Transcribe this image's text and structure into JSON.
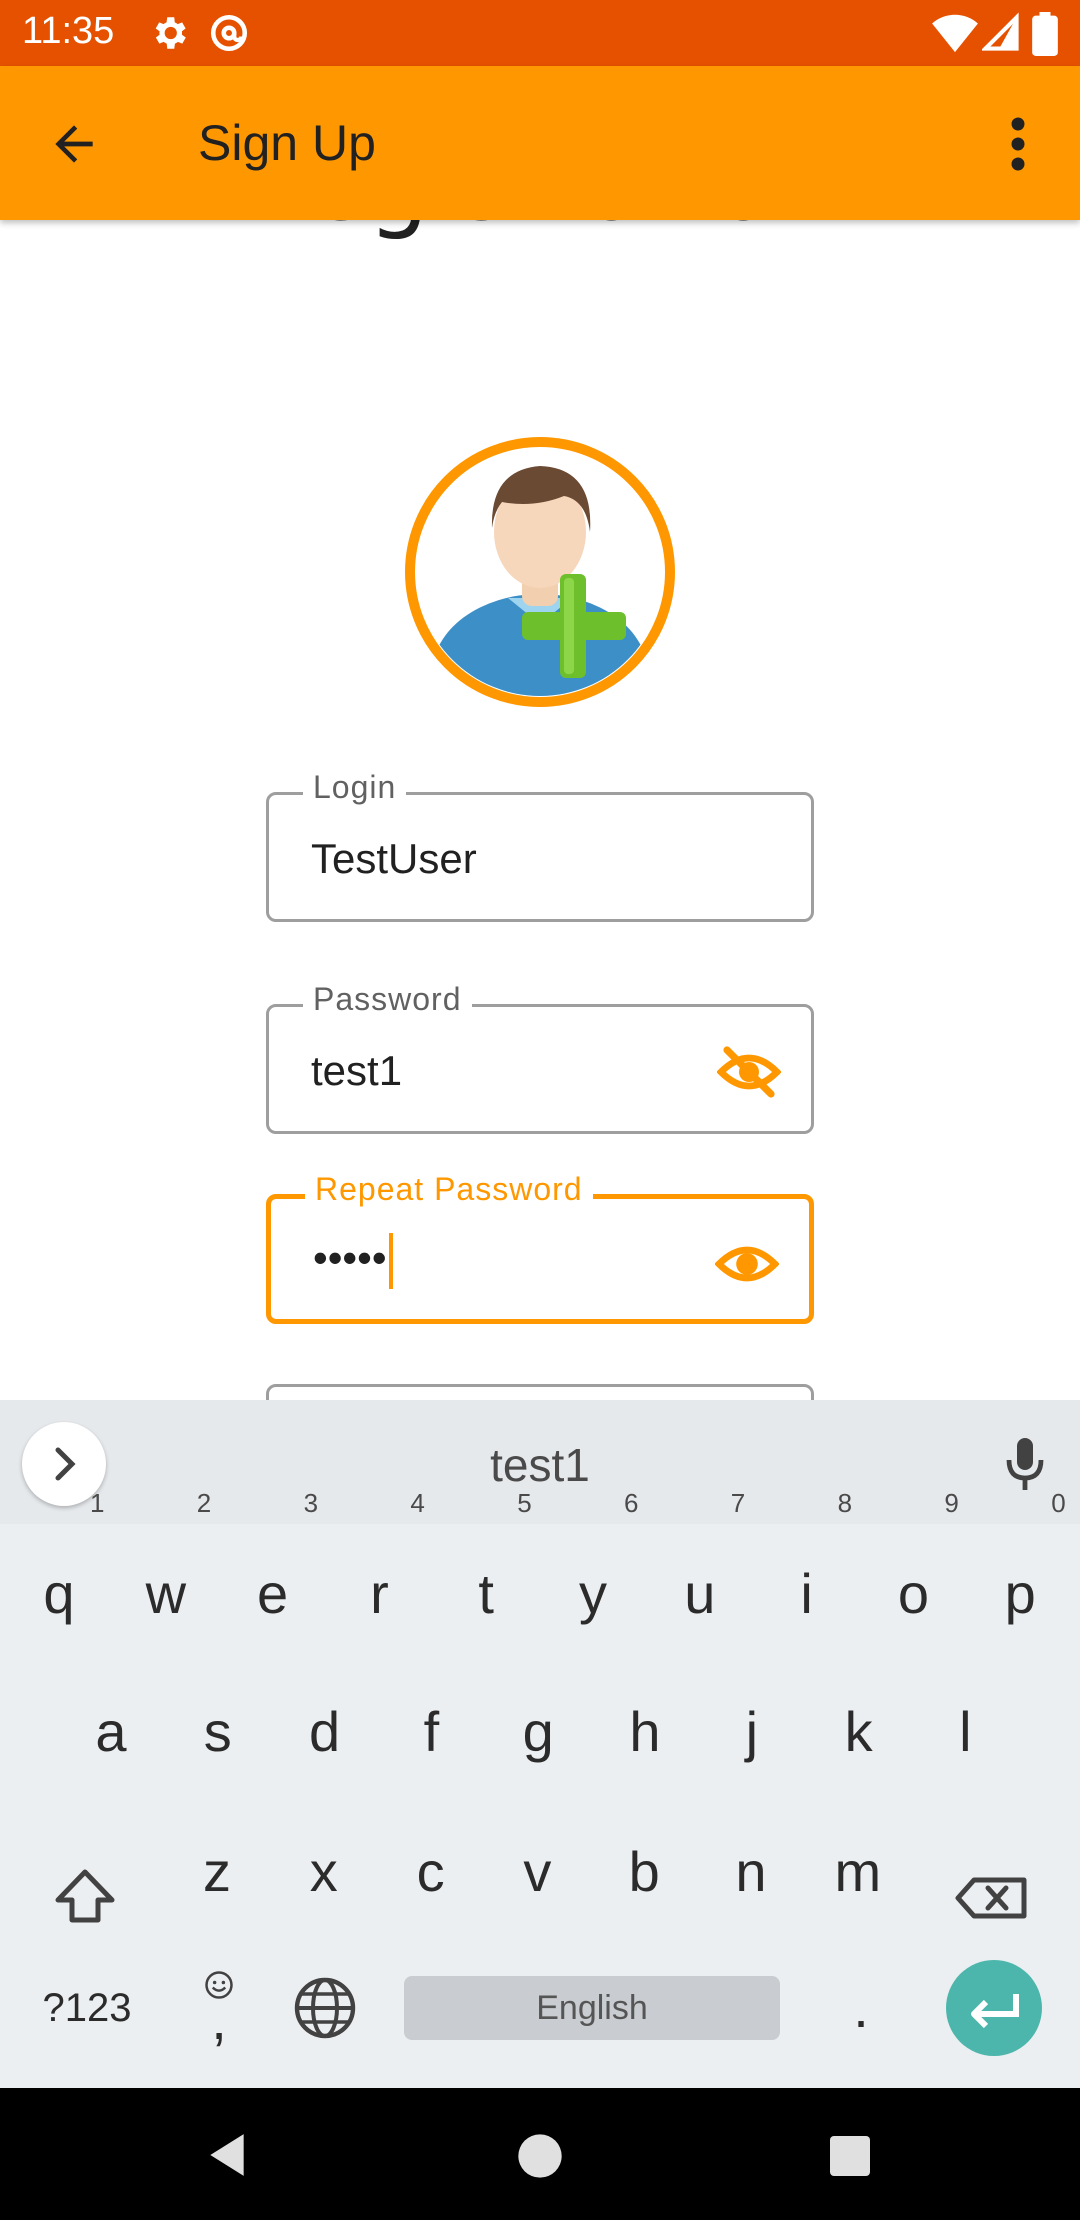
{
  "status_bar": {
    "time": "11:35",
    "icons": [
      "gear-icon",
      "at-sign-icon",
      "wifi-icon",
      "signal-icon",
      "battery-icon"
    ],
    "background": "#e65100"
  },
  "app_bar": {
    "title": "Sign Up",
    "background": "#ff9800",
    "back_icon": "arrow-back-icon",
    "menu_icon": "more-vert-icon"
  },
  "form": {
    "heading": "Registration",
    "avatar_icon": "add-user-avatar-icon",
    "login": {
      "label": "Login",
      "value": "TestUser"
    },
    "password": {
      "label": "Password",
      "value": "test1",
      "toggle_icon": "eye-off-icon"
    },
    "repeat_password": {
      "label": "Repeat Password",
      "value": "•••••",
      "toggle_icon": "eye-icon"
    },
    "accent_color": "#ff9800"
  },
  "keyboard": {
    "suggestion": "test1",
    "row1": [
      {
        "k": "q",
        "n": "1"
      },
      {
        "k": "w",
        "n": "2"
      },
      {
        "k": "e",
        "n": "3"
      },
      {
        "k": "r",
        "n": "4"
      },
      {
        "k": "t",
        "n": "5"
      },
      {
        "k": "y",
        "n": "6"
      },
      {
        "k": "u",
        "n": "7"
      },
      {
        "k": "i",
        "n": "8"
      },
      {
        "k": "o",
        "n": "9"
      },
      {
        "k": "p",
        "n": "0"
      }
    ],
    "row2": [
      "a",
      "s",
      "d",
      "f",
      "g",
      "h",
      "j",
      "k",
      "l"
    ],
    "row3": [
      "z",
      "x",
      "c",
      "v",
      "b",
      "n",
      "m"
    ],
    "symbols_label": "?123",
    "comma": ",",
    "space_label": "English",
    "period": ".",
    "enter_color": "#4db6ac"
  },
  "nav_bar": {
    "icons": [
      "back-triangle-icon",
      "home-circle-icon",
      "recents-square-icon"
    ]
  }
}
